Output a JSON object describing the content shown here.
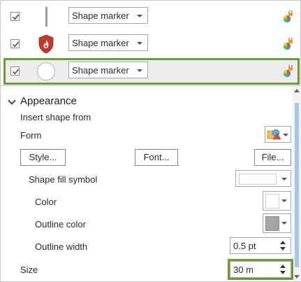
{
  "layers": [
    {
      "checked": true,
      "symbol": "vertical-bar-marker",
      "type_label": "Shape marker"
    },
    {
      "checked": true,
      "symbol": "fire-shield-marker",
      "type_label": "Shape marker"
    },
    {
      "checked": true,
      "symbol": "circle-marker",
      "type_label": "Shape marker",
      "selected": true
    }
  ],
  "appearance": {
    "section_title": "Appearance",
    "insert_shape_from": "Insert shape from",
    "form_label": "Form",
    "style_button": "Style...",
    "font_button": "Font...",
    "file_button": "File...",
    "shape_fill_symbol": "Shape fill symbol",
    "color_label": "Color",
    "outline_color_label": "Outline color",
    "outline_width_label": "Outline width",
    "outline_width_value": "0.5 pt",
    "size_label": "Size",
    "size_value": "30 m"
  },
  "colors": {
    "accent_green": "#6f9a3a",
    "shield_red": "#c0392b",
    "outline_swatch": "#a5a5a5",
    "scroll_thumb": "#a6c8e8"
  }
}
